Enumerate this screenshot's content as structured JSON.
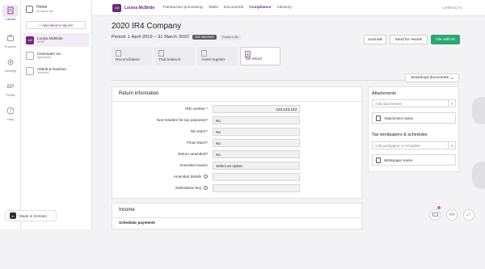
{
  "rail": {
    "items": [
      {
        "label": "Clients",
        "icon": "clients-icon"
      },
      {
        "label": "Practice",
        "icon": "practice-icon"
      },
      {
        "label": "Settings",
        "icon": "gear-icon"
      },
      {
        "label": "Profile",
        "icon": "profile-icon",
        "avatar": "EP"
      },
      {
        "label": "Help",
        "icon": "help-icon"
      }
    ]
  },
  "sidebar": {
    "home_title": "Home",
    "home_sub": "All clients list",
    "add_client": "+ Add client to My list",
    "clients": [
      {
        "initials": "LM",
        "name": "Louisa McBride",
        "sub": "SHSF",
        "active": true
      },
      {
        "initials": "",
        "name": "Clearwater Inc.",
        "sub": "Agriculture",
        "active": false
      },
      {
        "initials": "",
        "name": "Abbott & Rankine",
        "sub": "Industrial",
        "active": false
      }
    ]
  },
  "invision": {
    "logo": "in",
    "label": "Made in InVision"
  },
  "topbar": {
    "avatar": "LM",
    "client": "Louisa McBride",
    "nav": [
      "Transaction processing",
      "Tasks",
      "Documents",
      "Compliance",
      "Advisory"
    ],
    "active_nav": "Compliance",
    "code": "LMB002271"
  },
  "page": {
    "title": "2020 IR4 Company",
    "period": "Period: 1 April 2019 – 31 March 2020",
    "badge_dark": "JOB INBOARD",
    "badge_light": "Ready to file",
    "buttons": {
      "journals": "Journals",
      "rework": "Send for rework",
      "file": "File with IR"
    },
    "tiles": [
      "Reconciliation",
      "Trial balance",
      "Asset register",
      "Tax return"
    ],
    "active_tile": "Tax return",
    "download": "Download documents"
  },
  "return_info": {
    "title": "Return information",
    "rows": [
      {
        "label": "IRD number *",
        "value": "123,123,123",
        "align": "right",
        "info": false
      },
      {
        "label": "Non-resident for tax purposes?",
        "value": "No",
        "info": false
      },
      {
        "label": "Nil return?",
        "value": "No",
        "info": false
      },
      {
        "label": "Final return?",
        "value": "No",
        "info": false
      },
      {
        "label": "Return amended?",
        "value": "No",
        "info": false
      },
      {
        "label": "Amended reason",
        "value": "Select an option",
        "info": false
      },
      {
        "label": "Amended details",
        "value": "",
        "info": true
      },
      {
        "label": "Submission key",
        "value": "",
        "info": true
      }
    ]
  },
  "income": {
    "title": "Income",
    "sub": "Schedular payments"
  },
  "right_panel": {
    "attachments_title": "Attachments",
    "attachments_placeholder": "Add attachment",
    "attachment_name": "Attachment name",
    "workpapers_title": "Tax workpapers & schedules",
    "workpaper_placeholder": "Add workpaper or schedule",
    "workpaper_name": "Workpaper name"
  },
  "colors": {
    "brand": "#6b2a7e",
    "primary_button": "#2aa872"
  }
}
